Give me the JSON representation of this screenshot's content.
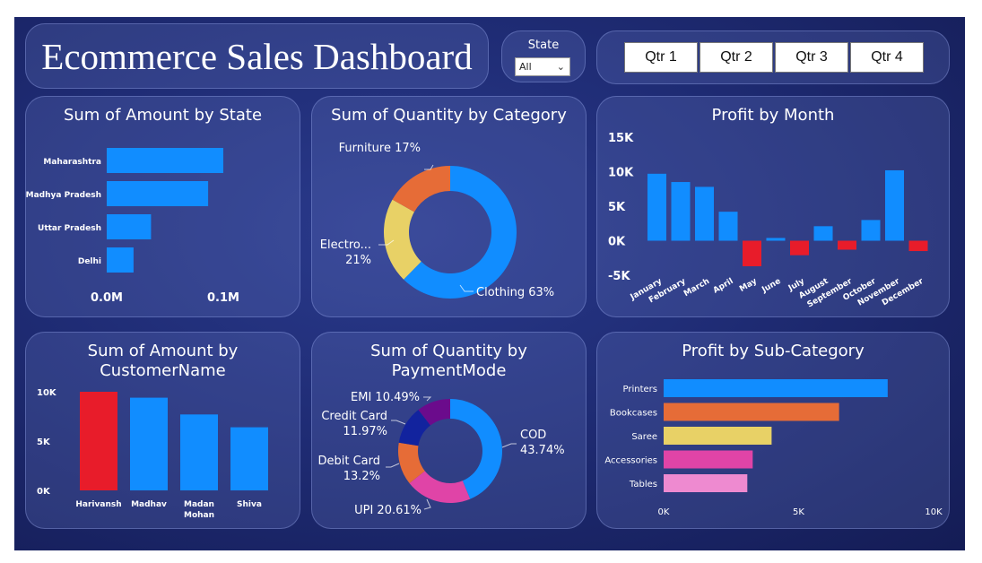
{
  "header": {
    "title": "Ecommerce Sales Dashboard",
    "state_filter": {
      "label": "State",
      "selected": "All"
    },
    "quarters": [
      "Qtr 1",
      "Qtr 2",
      "Qtr 3",
      "Qtr 4"
    ]
  },
  "colors": {
    "blue": "#118dff",
    "red": "#e81c2a",
    "orange": "#e66c37",
    "yellow": "#e8d166",
    "pink": "#e044a7",
    "light_pink": "#ee8ad0",
    "purple": "#6b0b8c",
    "navy": "#12239e"
  },
  "chart_data": [
    {
      "type": "bar",
      "orientation": "horizontal",
      "title": "Sum of Amount by State",
      "categories": [
        "Maharashtra",
        "Madhya Pradesh",
        "Uttar Pradesh",
        "Delhi"
      ],
      "values": [
        0.1,
        0.087,
        0.038,
        0.023
      ],
      "unit": "M",
      "xlim": [
        0,
        0.1
      ],
      "ticks": [
        "0.0M",
        "0.1M"
      ]
    },
    {
      "type": "pie",
      "donut": true,
      "title": "Sum of Quantity by Category",
      "slices": [
        {
          "name": "Clothing",
          "value": 63,
          "label": "Clothing 63%",
          "color": "#118dff"
        },
        {
          "name": "Electronics",
          "value": 21,
          "label_lines": [
            "Electro...",
            "21%"
          ],
          "color": "#e8d166"
        },
        {
          "name": "Furniture",
          "value": 17,
          "label": "Furniture 17%",
          "color": "#e66c37"
        }
      ]
    },
    {
      "type": "bar",
      "title": "Profit by Month",
      "categories": [
        "January",
        "February",
        "March",
        "April",
        "May",
        "June",
        "July",
        "August",
        "September",
        "October",
        "November",
        "December"
      ],
      "values": [
        9700,
        8500,
        7800,
        4200,
        -3700,
        400,
        -2100,
        2100,
        -1300,
        3000,
        10200,
        -1500
      ],
      "ylim": [
        -5000,
        15000
      ],
      "yticks": [
        "15K",
        "10K",
        "5K",
        "0K",
        "-5K"
      ]
    },
    {
      "type": "bar",
      "title_lines": [
        "Sum of Amount by",
        "CustomerName"
      ],
      "categories": [
        [
          "Harivansh"
        ],
        [
          "Madhav"
        ],
        [
          "Madan",
          "Mohan"
        ],
        [
          "Shiva"
        ]
      ],
      "values": [
        10000,
        9400,
        7700,
        6400
      ],
      "highlight_index": 0,
      "ylim": [
        0,
        10000
      ],
      "yticks": [
        "10K",
        "5K",
        "0K"
      ]
    },
    {
      "type": "pie",
      "donut": true,
      "title_lines": [
        "Sum of Quantity by",
        "PaymentMode"
      ],
      "slices": [
        {
          "name": "COD",
          "value": 43.74,
          "label_lines": [
            "COD",
            "43.74%"
          ],
          "color": "#118dff"
        },
        {
          "name": "UPI",
          "value": 20.61,
          "label_lines": [
            "UPI 20.61%"
          ],
          "color": "#e044a7"
        },
        {
          "name": "Debit Card",
          "value": 13.2,
          "label_lines": [
            "Debit Card",
            "13.2%"
          ],
          "color": "#e66c37"
        },
        {
          "name": "Credit Card",
          "value": 11.97,
          "label_lines": [
            "Credit Card",
            "11.97%"
          ],
          "color": "#12239e"
        },
        {
          "name": "EMI",
          "value": 10.49,
          "label_lines": [
            "EMI 10.49%"
          ],
          "color": "#6b0b8c"
        }
      ]
    },
    {
      "type": "bar",
      "orientation": "horizontal",
      "title": "Profit by Sub-Category",
      "categories": [
        "Printers",
        "Bookcases",
        "Saree",
        "Accessories",
        "Tables"
      ],
      "values": [
        8300,
        6500,
        4000,
        3300,
        3100
      ],
      "colors": [
        "#118dff",
        "#e66c37",
        "#e8d166",
        "#e044a7",
        "#ee8ad0"
      ],
      "xlim": [
        0,
        10000
      ],
      "xticks": [
        "0K",
        "5K",
        "10K"
      ]
    }
  ]
}
